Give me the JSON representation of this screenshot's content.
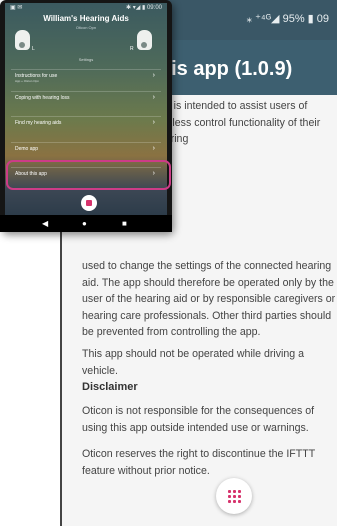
{
  "zoomed": {
    "status": "⁎ ⁺⁴ᴳ◢ 95% ▮ 09",
    "title": "t this app (1.0.9)",
    "p_intro": "app is intended to assist users of wireless control functionality of their hearing",
    "p_settings": "used to change the settings of the connected hearing aid. The app should therefore be operated only by the user of the hearing aid or by responsible caregivers or hearing care professionals. Other third parties should be prevented from controlling the app.",
    "p_vehicle": "This app should not be operated while driving a vehicle.",
    "disclaimer_heading": "Disclaimer",
    "p_disclaimer1": "Oticon is not responsible for the consequences of using this app outside intended use or warnings.",
    "p_disclaimer2": "Oticon reserves the right to discontinue the IFTTT feature without prior notice.",
    "fab_icon": "grid-icon"
  },
  "phone": {
    "status_left": "▣ ✉",
    "status_right": "✱ ▾◢ ▮ 09:00",
    "title": "William's Hearing Aids",
    "subtitle": "Oticon Opn",
    "left_aid_label": "L",
    "right_aid_label": "R",
    "section_label": "Settings",
    "menu": [
      {
        "label": "Instructions for use",
        "sub": "App + Oticon Opn"
      },
      {
        "label": "Coping with hearing loss",
        "sub": ""
      },
      {
        "label": "Find my hearing aids",
        "sub": ""
      },
      {
        "label": "Demo app",
        "sub": ""
      },
      {
        "label": "About this app",
        "sub": ""
      }
    ],
    "chevron": "›",
    "nav_back": "◀",
    "nav_home": "●",
    "nav_recent": "■"
  },
  "colors": {
    "header": "#3d5f70",
    "accent": "#d6336c",
    "highlight": "#cc3c87"
  }
}
